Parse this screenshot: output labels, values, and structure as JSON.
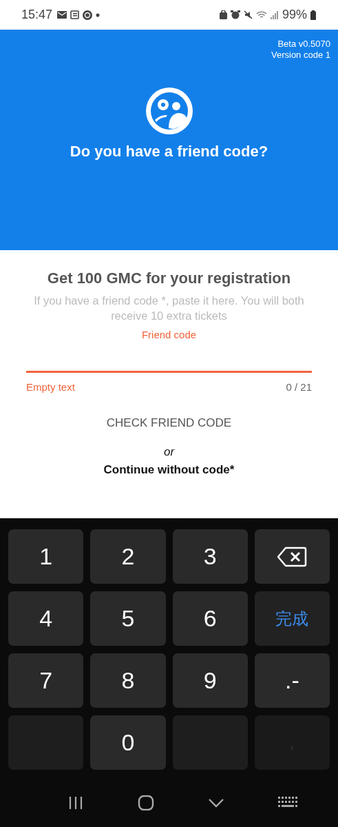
{
  "status_bar": {
    "time": "15:47",
    "battery": "99%"
  },
  "header": {
    "version": "Beta v0.5070",
    "version_code": "Version code 1",
    "title": "Do you have a friend code?"
  },
  "content": {
    "heading": "Get 100 GMC for your registration",
    "description": "If you have a friend code *, paste it here. You will both receive 10 extra tickets",
    "field": {
      "label": "Friend code",
      "error": true,
      "helper": "Empty text",
      "counter": "0 / 21"
    },
    "check_button": "CHECK FRIEND CODE",
    "or": "or",
    "continue_link": "Continue without code*"
  },
  "keyboard": {
    "keys": [
      {
        "kind": "char",
        "label": "1"
      },
      {
        "kind": "char",
        "label": "2"
      },
      {
        "kind": "char",
        "label": "3"
      },
      {
        "kind": "backspace"
      },
      {
        "kind": "char",
        "label": "4"
      },
      {
        "kind": "char",
        "label": "5"
      },
      {
        "kind": "char",
        "label": "6"
      },
      {
        "kind": "action",
        "label": "完成"
      },
      {
        "kind": "char",
        "label": "7"
      },
      {
        "kind": "char",
        "label": "8"
      },
      {
        "kind": "char",
        "label": "9"
      },
      {
        "kind": "char",
        "label": ".-"
      },
      {
        "kind": "blank"
      },
      {
        "kind": "char",
        "label": "0"
      },
      {
        "kind": "blank"
      },
      {
        "kind": "dim",
        "label": ","
      }
    ]
  }
}
